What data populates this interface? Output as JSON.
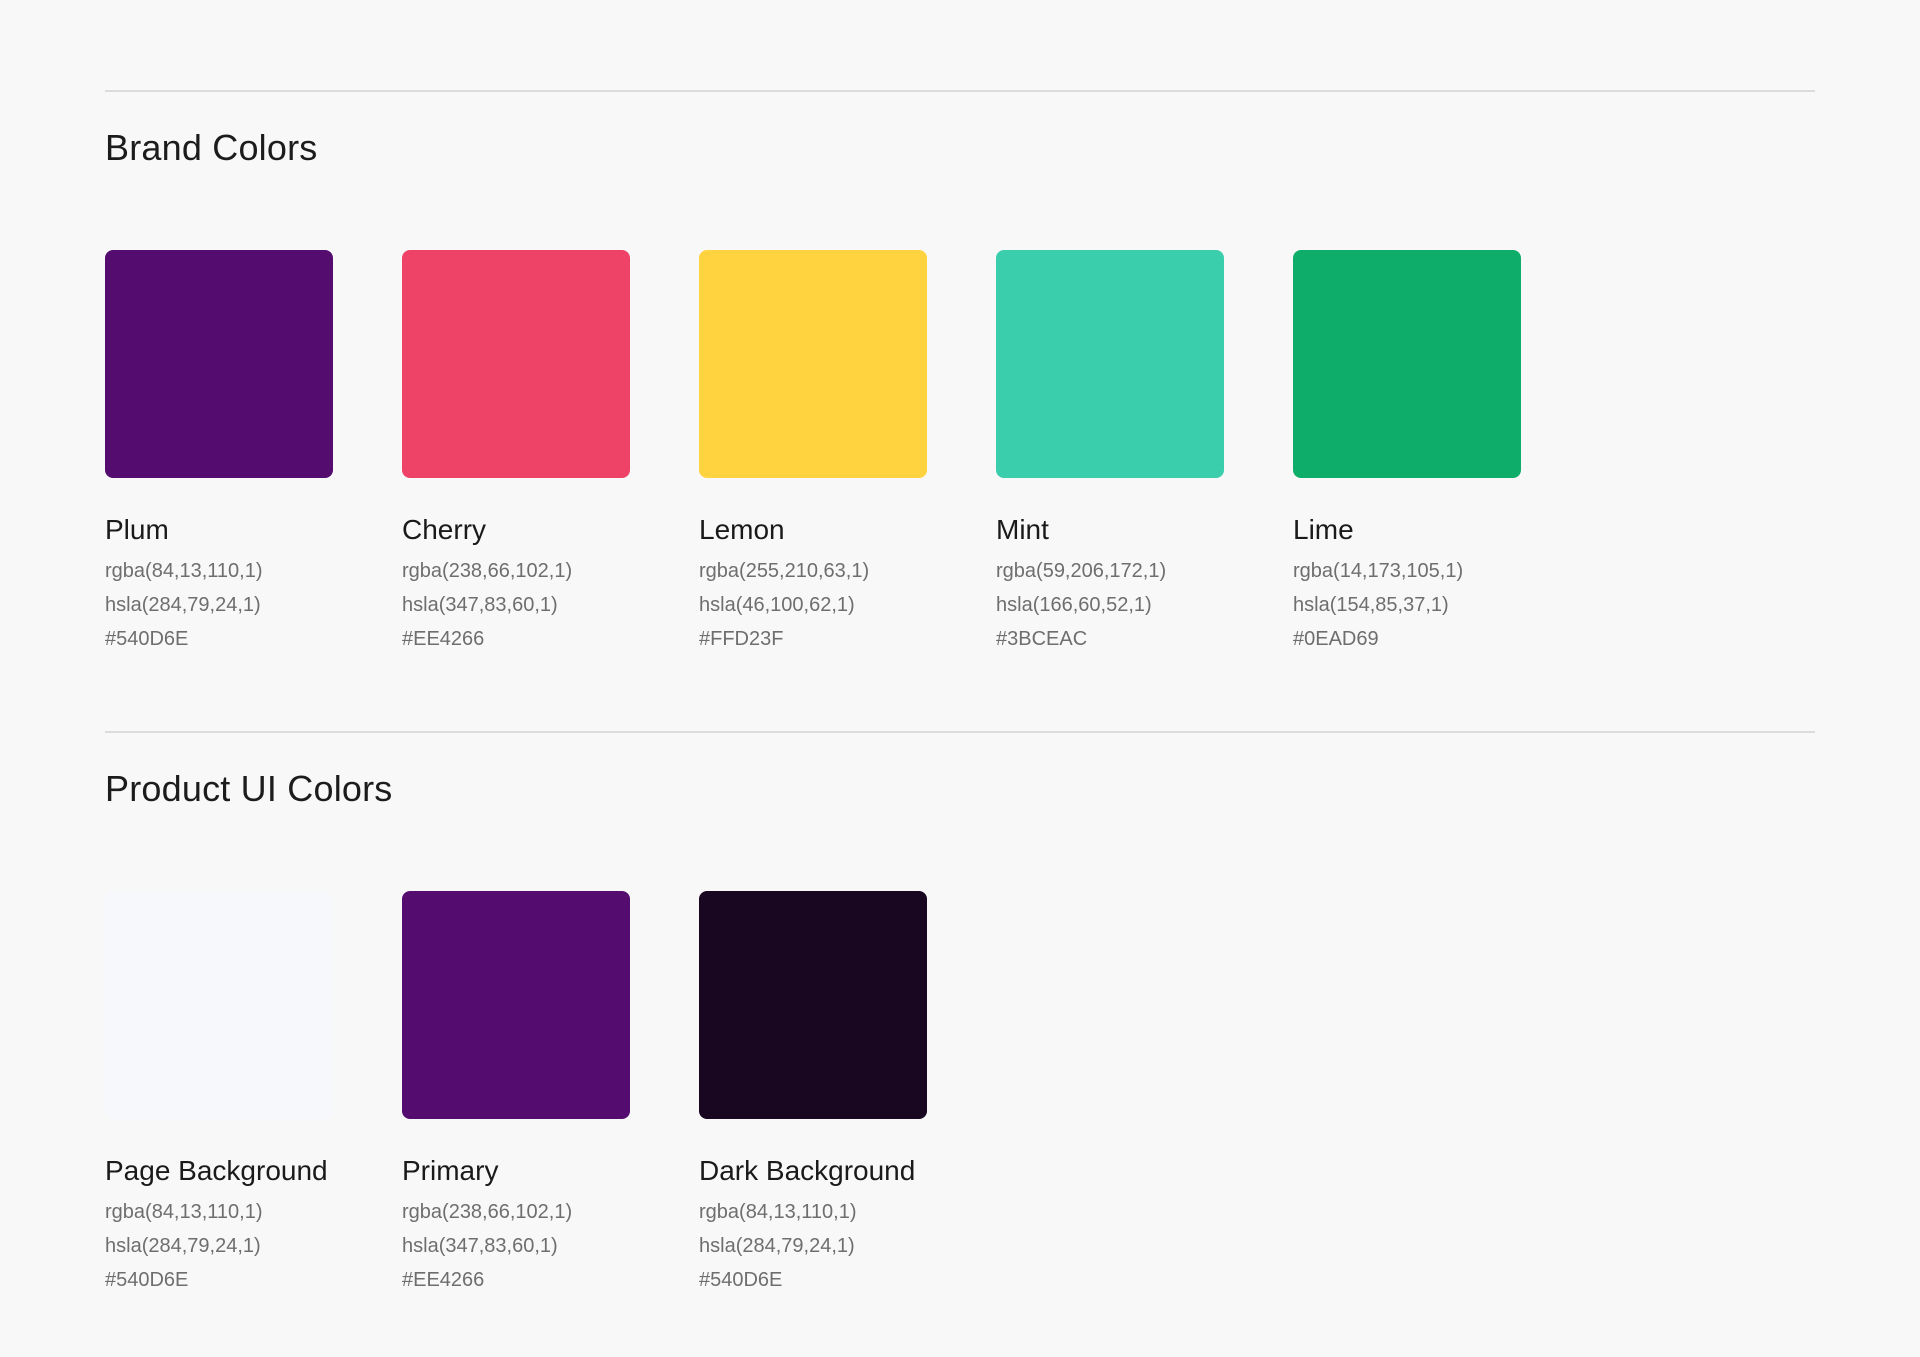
{
  "brand": {
    "title": "Brand Colors",
    "swatches": [
      {
        "name": "Plum",
        "rgba": "rgba(84,13,110,1)",
        "hsla": "hsla(284,79,24,1)",
        "hex": "#540D6E",
        "color": "#540D6E"
      },
      {
        "name": "Cherry",
        "rgba": "rgba(238,66,102,1)",
        "hsla": "hsla(347,83,60,1)",
        "hex": "#EE4266",
        "color": "#EE4266"
      },
      {
        "name": "Lemon",
        "rgba": "rgba(255,210,63,1)",
        "hsla": "hsla(46,100,62,1)",
        "hex": "#FFD23F",
        "color": "#FFD23F"
      },
      {
        "name": "Mint",
        "rgba": "rgba(59,206,172,1)",
        "hsla": "hsla(166,60,52,1)",
        "hex": "#3BCEAC",
        "color": "#3BCEAC"
      },
      {
        "name": "Lime",
        "rgba": "rgba(14,173,105,1)",
        "hsla": "hsla(154,85,37,1)",
        "hex": "#0EAD69",
        "color": "#0EAD69"
      }
    ]
  },
  "product": {
    "title": "Product UI Colors",
    "swatches": [
      {
        "name": "Page Background",
        "rgba": "rgba(84,13,110,1)",
        "hsla": "hsla(284,79,24,1)",
        "hex": "#540D6E",
        "color": "#F7F8FB"
      },
      {
        "name": "Primary",
        "rgba": "rgba(238,66,102,1)",
        "hsla": "hsla(347,83,60,1)",
        "hex": "#EE4266",
        "color": "#540D6E"
      },
      {
        "name": "Dark Background",
        "rgba": "rgba(84,13,110,1)",
        "hsla": "hsla(284,79,24,1)",
        "hex": "#540D6E",
        "color": "#190620"
      }
    ]
  }
}
